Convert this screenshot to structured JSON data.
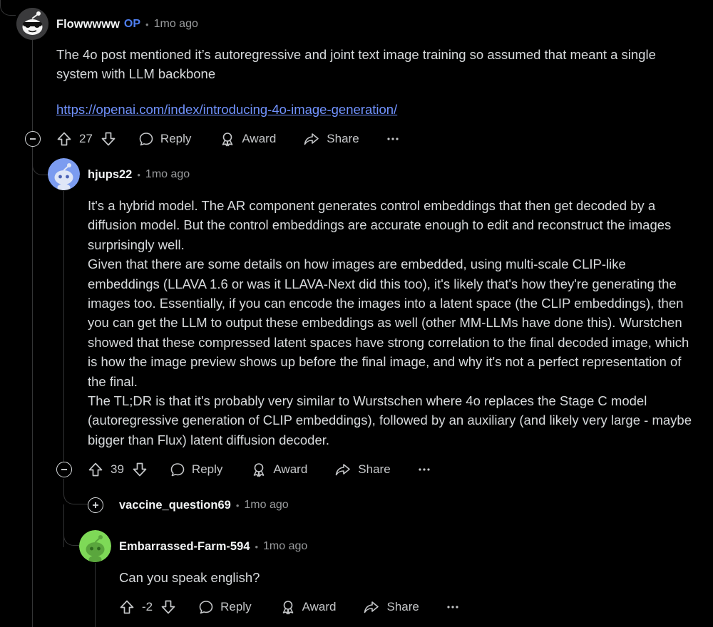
{
  "comments": [
    {
      "author": "Flowwwww",
      "op_badge": "OP",
      "time": "1mo ago",
      "paragraphs": [
        "The 4o post mentioned it’s autoregressive and joint text image training so assumed that meant a single system with LLM backbone"
      ],
      "link": "https://openai.com/index/introducing-4o-image-generation/",
      "votes": "27",
      "reply_label": "Reply",
      "award_label": "Award",
      "share_label": "Share",
      "avatar_color": "#3a3a3a"
    },
    {
      "author": "hjups22",
      "time": "1mo ago",
      "paragraphs": [
        "It's a hybrid model. The AR component generates control embeddings that then get decoded by a diffusion model. But the control embeddings are accurate enough to edit and reconstruct the images surprisingly well.",
        "Given that there are some details on how images are embedded, using multi-scale CLIP-like embeddings (LLAVA 1.6 or was it LLAVA-Next did this too), it's likely that's how they're generating the images too. Essentially, if you can encode the images into a latent space (the CLIP embeddings), then you can get the LLM to output these embeddings as well (other MM-LLMs have done this). Wurstchen showed that these compressed latent spaces have strong correlation to the final decoded image, which is how the image preview shows up before the final image, and why it's not a perfect representation of the final.",
        "The TL;DR is that it's probably very similar to Wurstschen where 4o replaces the Stage C model (autoregressive generation of CLIP embeddings), followed by an auxiliary (and likely very large - maybe bigger than Flux) latent diffusion decoder."
      ],
      "votes": "39",
      "reply_label": "Reply",
      "award_label": "Award",
      "share_label": "Share",
      "avatar_color": "#7c9cf0"
    },
    {
      "author": "vaccine_question69",
      "time": "1mo ago",
      "collapsed": true
    },
    {
      "author": "Embarrassed-Farm-594",
      "time": "1mo ago",
      "paragraphs": [
        "Can you speak english?"
      ],
      "votes": "-2",
      "reply_label": "Reply",
      "award_label": "Award",
      "share_label": "Share",
      "avatar_color": "#7ed957"
    }
  ],
  "colors": {
    "background": "#000000",
    "text": "#d7dadc",
    "link": "#7193ff",
    "op_badge": "#4f7ff0",
    "thread_line": "#343536"
  },
  "icons": [
    "upvote-icon",
    "downvote-icon",
    "reply-icon",
    "award-icon",
    "share-icon",
    "more-icon",
    "collapse-icon",
    "expand-icon"
  ]
}
